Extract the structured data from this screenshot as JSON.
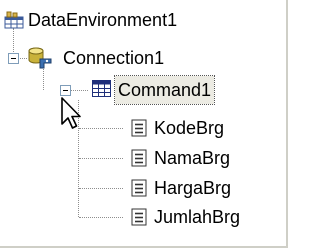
{
  "tree": {
    "root": {
      "label": "DataEnvironment1",
      "icon": "data-environment-icon"
    },
    "connection": {
      "label": "Connection1",
      "icon": "database-connection-icon",
      "expanded": true
    },
    "command": {
      "label": "Command1",
      "icon": "table-command-icon",
      "expanded": true,
      "selected": true
    },
    "fields": [
      {
        "label": "KodeBrg",
        "icon": "field-icon"
      },
      {
        "label": "NamaBrg",
        "icon": "field-icon"
      },
      {
        "label": "HargaBrg",
        "icon": "field-icon"
      },
      {
        "label": "JumlahBrg",
        "icon": "field-icon"
      }
    ]
  },
  "colors": {
    "tree_lines": "#8e8e8e",
    "selection_bg": "#ecebe3",
    "expander_border": "#7f9db9"
  }
}
